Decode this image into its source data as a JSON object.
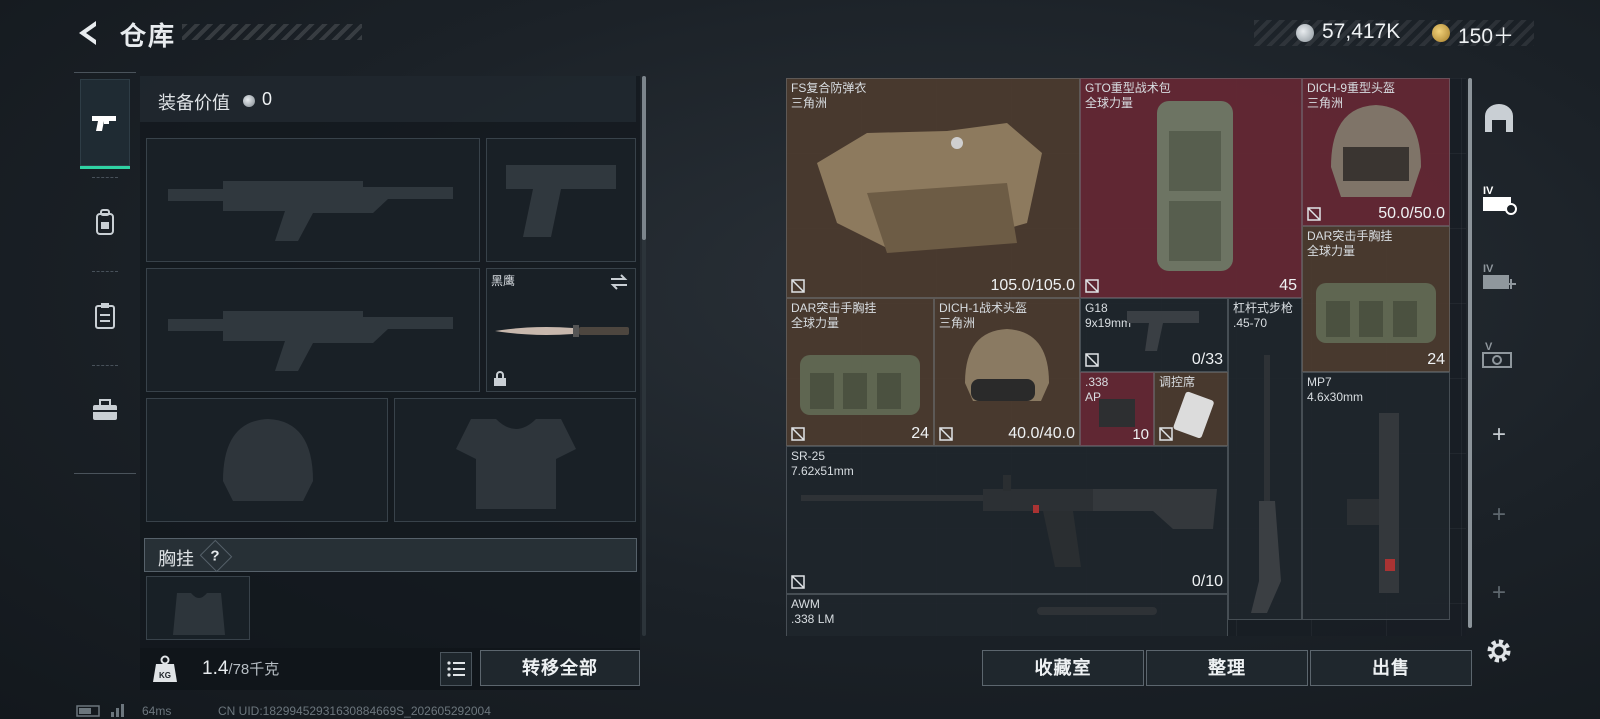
{
  "header": {
    "title": "仓库",
    "currency": [
      {
        "value": "57,417K",
        "icon": "silver-coin-icon"
      },
      {
        "value": "150＋",
        "icon": "gold-coin-icon"
      }
    ]
  },
  "nav": {
    "items": [
      {
        "name": "weapons-tab",
        "icon": "pistol-icon",
        "active": true
      },
      {
        "name": "backpack-tab",
        "icon": "backpack-icon",
        "active": false
      },
      {
        "name": "clipboard-tab",
        "icon": "clipboard-icon",
        "active": false
      },
      {
        "name": "toolbox-tab",
        "icon": "toolbox-icon",
        "active": false
      }
    ]
  },
  "equipment": {
    "value_label": "装备价值",
    "value": "0",
    "melee": {
      "name": "黑鹰"
    },
    "chest_rig_label": "胸挂",
    "help": "?",
    "weight": "1.4",
    "weight_max": "/78千克",
    "transfer_all": "转移全部"
  },
  "storage": {
    "items": [
      {
        "line1": "FS复合防弹衣",
        "line2": "三角洲",
        "stat": "105.0/105.0",
        "color": "#4e3c30"
      },
      {
        "line1": "GTO重型战术包",
        "line2": "全球力量",
        "stat": "45",
        "color": "#662834"
      },
      {
        "line1": "DICH-9重型头盔",
        "line2": "三角洲",
        "stat": "50.0/50.0",
        "color": "#662834"
      },
      {
        "line1": "DAR突击手胸挂",
        "line2": "全球力量",
        "stat": "24",
        "color": "#4e3c30"
      },
      {
        "line1": "DAR突击手胸挂",
        "line2": "全球力量",
        "stat": "24",
        "color": "#4e3c30"
      },
      {
        "line1": "DICH-1战术头盔",
        "line2": "三角洲",
        "stat": "40.0/40.0",
        "color": "#4e3c30"
      },
      {
        "line1": "G18",
        "line2": "9x19mm",
        "stat": "0/33",
        "color": "#1f262c"
      },
      {
        "line1": "杠杆式步枪",
        "line2": ".45-70",
        "stat": "",
        "color": "#1f262c"
      },
      {
        "line1": ".338",
        "line2": "AP",
        "stat": "10",
        "color": "#662834"
      },
      {
        "line1": "调控席",
        "line2": "",
        "stat": "",
        "color": "#4e3c30"
      },
      {
        "line1": "MP7",
        "line2": "4.6x30mm",
        "stat": "",
        "color": "#1f262c"
      },
      {
        "line1": "SR-25",
        "line2": "7.62x51mm",
        "stat": "0/10",
        "color": "#1f262c"
      },
      {
        "line1": "AWM",
        "line2": ".338 LM",
        "stat": "",
        "color": "#1f262c"
      }
    ],
    "actions": [
      "收藏室",
      "整理",
      "出售"
    ]
  },
  "side_tabs": [
    "safe-icon",
    "storage-iv-icon",
    "storage-iv-add-icon",
    "storage-v-icon",
    "plus-icon",
    "plus-icon",
    "plus-icon",
    "settings-icon"
  ],
  "footer": {
    "ping": "64ms",
    "uid": "CN UID:18299452931630884669S_202605292004"
  }
}
